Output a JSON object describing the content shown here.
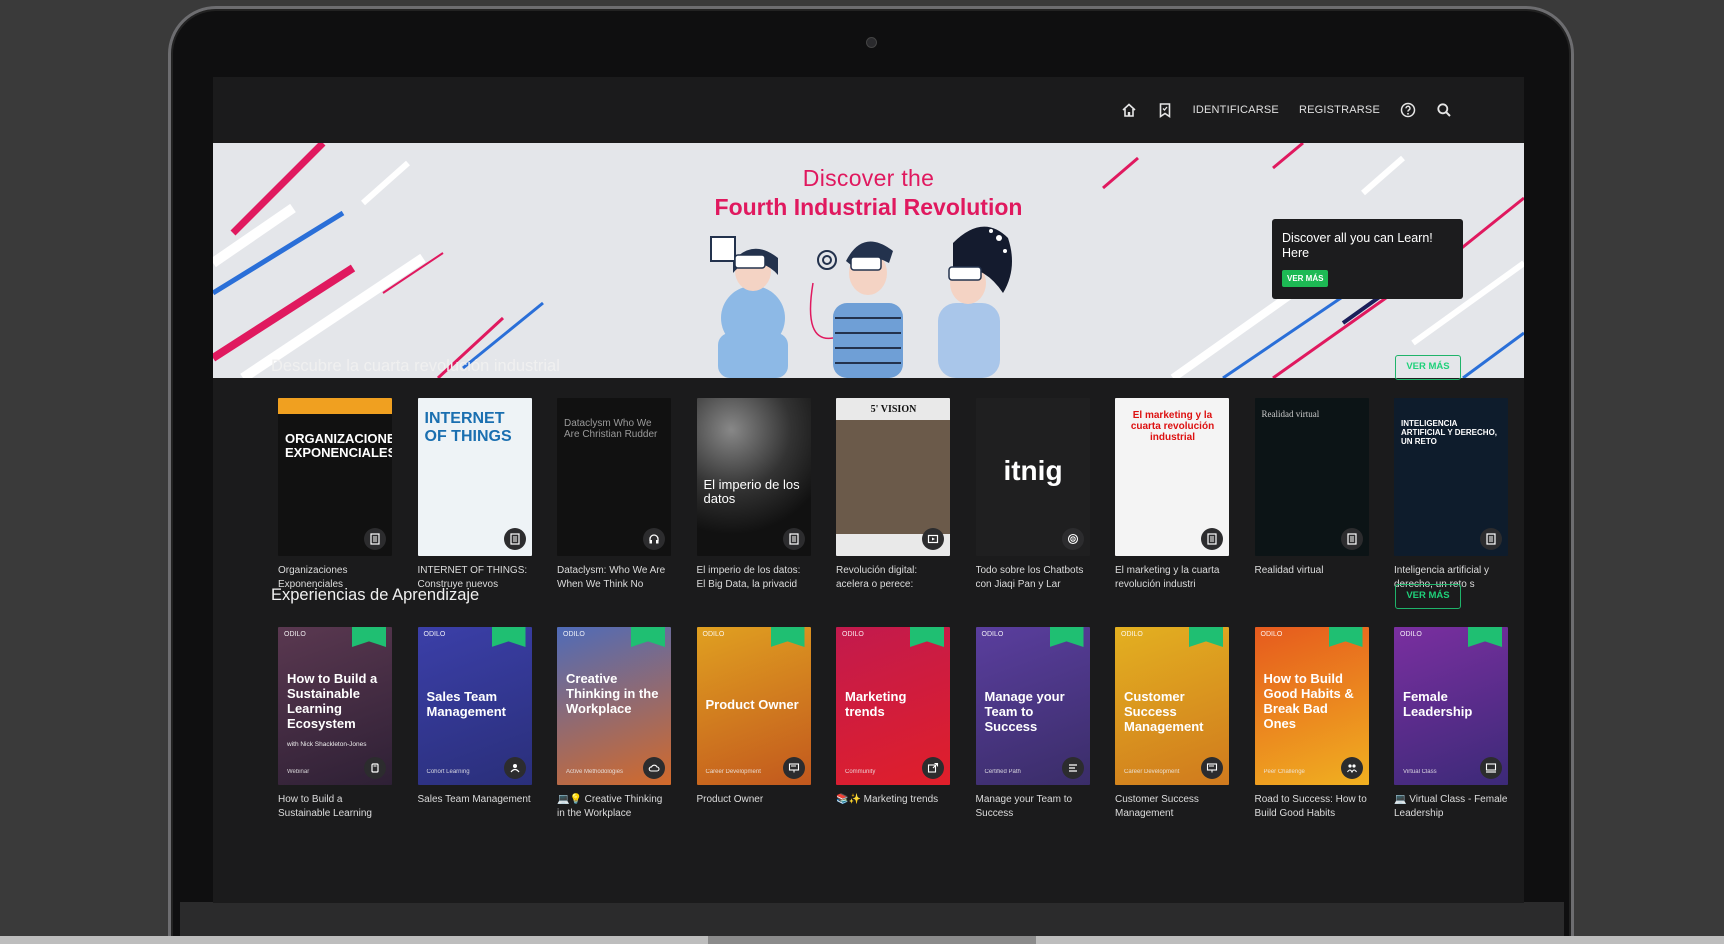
{
  "nav": {
    "home_icon": "home-icon",
    "bookmark_icon": "bookmark-icon",
    "login": "IDENTIFICARSE",
    "register": "REGISTRARSE",
    "help_icon": "help-icon",
    "search_icon": "search-icon"
  },
  "banner": {
    "title_line1": "Discover the",
    "title_line2": "Fourth Industrial Revolution",
    "card_text": "Discover all you can Learn! Here",
    "card_button": "VER MÁS"
  },
  "section1": {
    "title": "Descubre la cuarta revolución industrial",
    "see_more": "VER MÁS",
    "items": [
      {
        "cover_text": "ORGANIZACIONES EXPONENCIALES",
        "caption": "Organizaciones Exponenciales",
        "badge": "document-icon",
        "bg": "#1a1a1a"
      },
      {
        "cover_text": "INTERNET OF THINGS",
        "caption": "INTERNET OF THINGS: Construye nuevos",
        "badge": "document-icon",
        "bg": "#eef3f6"
      },
      {
        "cover_text": "Dataclysm Who We Are Christian Rudder",
        "caption": "Dataclysm: Who We Are When We Think No",
        "badge": "headphones-icon",
        "bg": "#111111"
      },
      {
        "cover_text": "El imperio de los datos",
        "caption": "El imperio de los datos: El Big Data, la privacid",
        "badge": "document-icon",
        "bg": "#1e2430"
      },
      {
        "cover_text": "5' VISION",
        "caption": "Revolución digital: acelera o perece: Presiden",
        "badge": "video-icon",
        "bg": "#e9e9e9"
      },
      {
        "cover_text": "itnig",
        "caption": "Todo sobre los Chatbots con Jiaqi Pan y Lar",
        "badge": "podcast-icon",
        "bg": "#1f1f20"
      },
      {
        "cover_text": "El marketing y la cuarta revolución industrial",
        "caption": "El marketing y la cuarta revolución industri",
        "badge": "document-icon",
        "bg": "#f4f4f4"
      },
      {
        "cover_text": "Realidad virtual",
        "caption": "Realidad virtual",
        "badge": "document-icon",
        "bg": "#0c1416"
      },
      {
        "cover_text": "INTELIGENCIA ARTIFICIAL Y DERECHO, UN RETO",
        "caption": "Inteligencia artificial y derecho, un reto s",
        "badge": "document-icon",
        "bg": "#0e1c2c"
      }
    ]
  },
  "section2": {
    "title": "Experiencias de Aprendizaje",
    "see_more": "VER MÁS",
    "brand": "ODILO",
    "items": [
      {
        "title": "How to Build a Sustainable Learning Ecosystem",
        "sub": "with Nick Shackleton-Jones",
        "type": "Webinar",
        "caption": "How to Build a Sustainable Learning Ecosystem",
        "badge": "webinar-icon",
        "c1": "#5a3850",
        "c2": "#2e2035"
      },
      {
        "title": "Sales Team Management",
        "sub": "",
        "type": "Cohort Learning",
        "caption": "Sales Team Management",
        "badge": "cohort-icon",
        "c1": "#3b3fa8",
        "c2": "#2a2f7a"
      },
      {
        "title": "Creative Thinking in the Workplace",
        "sub": "",
        "type": "Active Methodologies",
        "caption": "💻💡 Creative Thinking in the Workplace",
        "badge": "cloud-icon",
        "c1": "#4f6bb8",
        "c2": "#d36a2a"
      },
      {
        "title": "Product Owner",
        "sub": "",
        "type": "Career Development",
        "caption": "Product Owner",
        "badge": "presentation-icon",
        "c1": "#e0a020",
        "c2": "#c2581e"
      },
      {
        "title": "Marketing trends",
        "sub": "",
        "type": "Community",
        "caption": "📚✨ Marketing trends",
        "badge": "share-icon",
        "c1": "#c21a4d",
        "c2": "#e01f2a"
      },
      {
        "title": "Manage your Team to Success",
        "sub": "",
        "type": "Certified Path",
        "caption": "Manage your Team to Success",
        "badge": "path-icon",
        "c1": "#5a3e9e",
        "c2": "#3a2d68"
      },
      {
        "title": "Customer Success Management",
        "sub": "",
        "type": "Career Development",
        "caption": "Customer Success Management",
        "badge": "presentation-icon",
        "c1": "#e3b020",
        "c2": "#d07a1e"
      },
      {
        "title": "How to Build Good Habits & Break Bad Ones",
        "sub": "",
        "type": "Peer Challenge",
        "caption": "Road to Success: How to Build Good Habits",
        "badge": "people-icon",
        "c1": "#e65a1e",
        "c2": "#f0b020"
      },
      {
        "title": "Female Leadership",
        "sub": "",
        "type": "Virtual Class",
        "caption": "💻 Virtual Class - Female Leadership",
        "badge": "class-icon",
        "c1": "#7a2fa0",
        "c2": "#3c2a78"
      }
    ]
  },
  "colors": {
    "accent": "#1fd17a",
    "brand_pink": "#e0195f",
    "background": "#1b1b1c"
  }
}
